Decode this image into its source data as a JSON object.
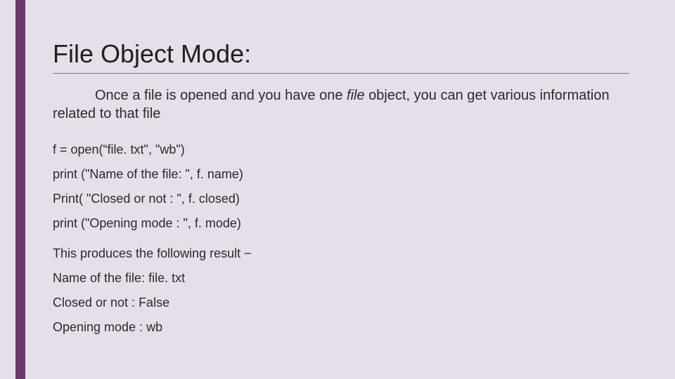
{
  "title": "File Object Mode:",
  "intro_part1": "Once a file is opened and you have one ",
  "intro_italic": "file",
  "intro_part2": " object, you can get various information related to that file",
  "code": {
    "l1": "f = open(“file. txt\", \"wb\")",
    "l2": "print (\"Name of the file: \", f. name)",
    "l3": "Print( \"Closed or not : \", f. closed)",
    "l4": "print (\"Opening mode : \", f. mode)"
  },
  "result": {
    "header": "This produces the following result −",
    "r1": "Name of the file:  file. txt",
    "r2": "Closed or not :  False",
    "r3": "Opening mode :  wb"
  }
}
